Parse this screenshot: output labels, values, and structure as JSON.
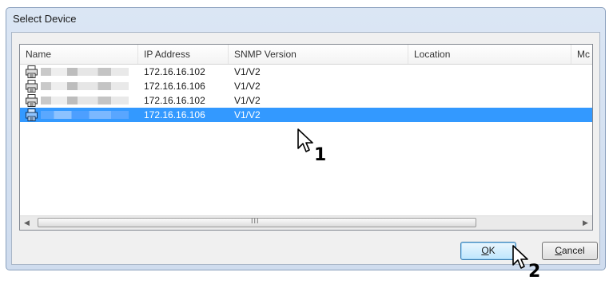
{
  "window": {
    "title": "Select Device"
  },
  "list": {
    "columns": [
      "Name",
      "IP Address",
      "SNMP Version",
      "Location",
      "Mc"
    ],
    "rows": [
      {
        "ip": "172.16.16.102",
        "snmp": "V1/V2",
        "selected": false
      },
      {
        "ip": "172.16.16.106",
        "snmp": "V1/V2",
        "selected": false
      },
      {
        "ip": "172.16.16.102",
        "snmp": "V1/V2",
        "selected": false
      },
      {
        "ip": "172.16.16.106",
        "snmp": "V1/V2",
        "selected": true
      }
    ],
    "scroll_left": "◀",
    "scroll_right": "▶",
    "scroll_grip": "III"
  },
  "buttons": {
    "ok_mnemonic": "O",
    "ok_rest": "K",
    "cancel_mnemonic": "C",
    "cancel_rest": "ancel"
  },
  "callouts": {
    "step1": "1",
    "step2": "2"
  },
  "colors": {
    "selection": "#3399ff",
    "dialog_frame": "#cfdcee"
  },
  "icons": {
    "device": "printer-icon",
    "cursor": "mouse-pointer-icon"
  }
}
